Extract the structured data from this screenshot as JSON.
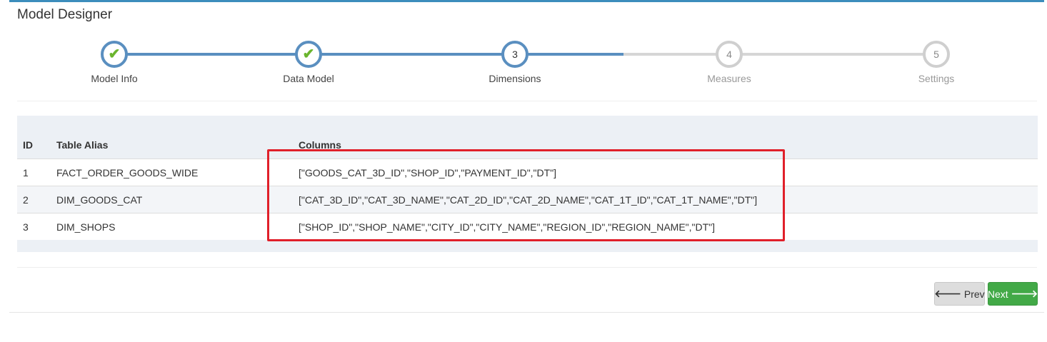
{
  "app": {
    "title": "Model Designer"
  },
  "wizard": {
    "steps": [
      {
        "label": "Model Info",
        "state": "done",
        "number": "1"
      },
      {
        "label": "Data Model",
        "state": "done",
        "number": "2"
      },
      {
        "label": "Dimensions",
        "state": "active",
        "number": "3"
      },
      {
        "label": "Measures",
        "state": "todo",
        "number": "4"
      },
      {
        "label": "Settings",
        "state": "todo",
        "number": "5"
      }
    ],
    "check_icon": "check-icon"
  },
  "table": {
    "headers": {
      "id": "ID",
      "alias": "Table Alias",
      "columns": "Columns"
    },
    "rows": [
      {
        "id": "1",
        "alias": "FACT_ORDER_GOODS_WIDE",
        "columns": "[\"GOODS_CAT_3D_ID\",\"SHOP_ID\",\"PAYMENT_ID\",\"DT\"]"
      },
      {
        "id": "2",
        "alias": "DIM_GOODS_CAT",
        "columns": "[\"CAT_3D_ID\",\"CAT_3D_NAME\",\"CAT_2D_ID\",\"CAT_2D_NAME\",\"CAT_1T_ID\",\"CAT_1T_NAME\",\"DT\"]"
      },
      {
        "id": "3",
        "alias": "DIM_SHOPS",
        "columns": "[\"SHOP_ID\",\"SHOP_NAME\",\"CITY_ID\",\"CITY_NAME\",\"REGION_ID\",\"REGION_NAME\",\"DT\"]"
      }
    ]
  },
  "buttons": {
    "prev_label": "Prev",
    "next_label": "Next",
    "prev_icon": "arrow-left-icon",
    "next_icon": "arrow-right-icon"
  },
  "colors": {
    "accent": "#3c8dbc",
    "step_done": "#5a8fc0",
    "check": "#6bb52e",
    "highlight": "#e0202a",
    "next_button": "#42a947"
  }
}
